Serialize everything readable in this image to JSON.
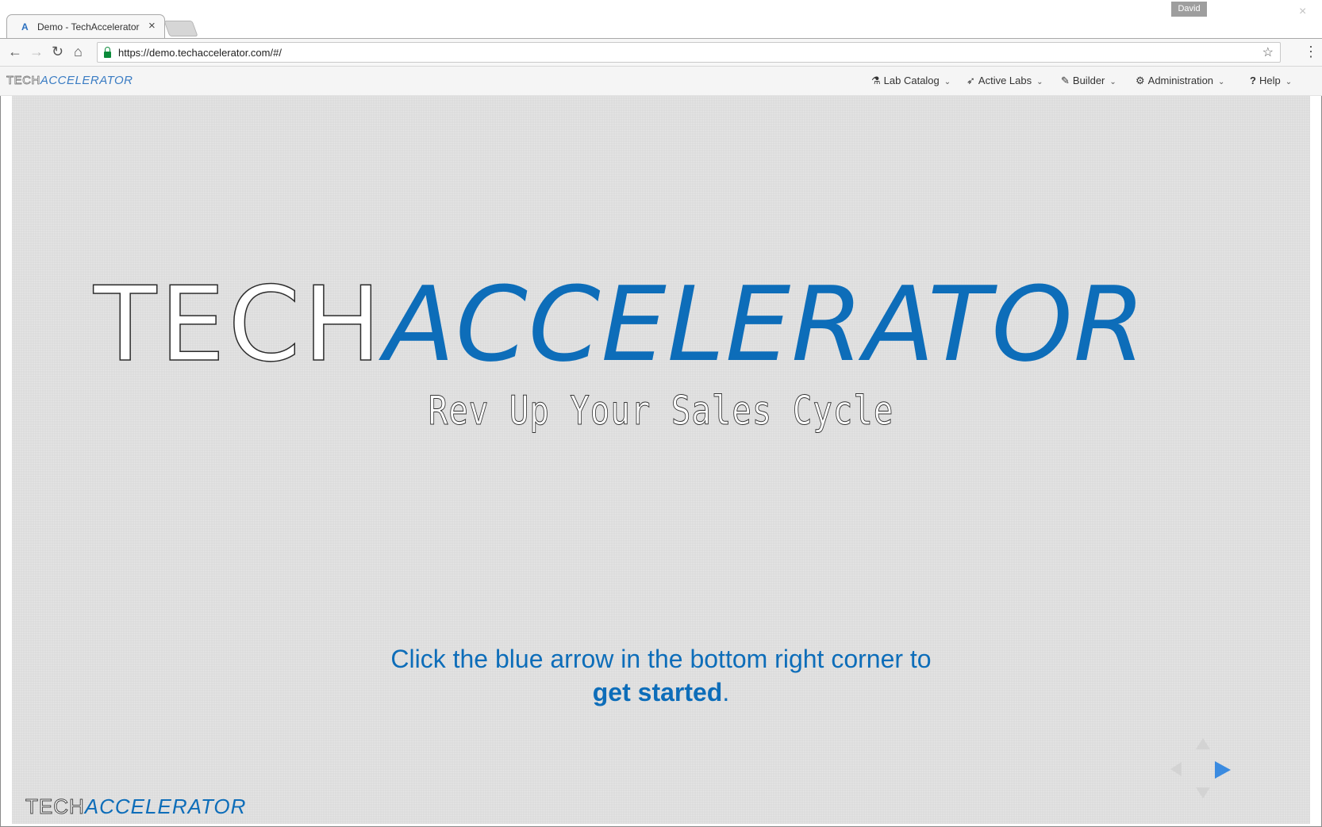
{
  "browser": {
    "tab_title": "Demo - TechAccelerator",
    "tab_close": "×",
    "favicon": "A",
    "profile_name": "David",
    "window_close": "×",
    "url": "https://demo.techaccelerator.com/#/",
    "icons": {
      "back": "←",
      "forward": "→",
      "reload": "↻",
      "home": "⌂",
      "star": "☆",
      "menu": "⋮"
    }
  },
  "nav": {
    "logo_tech": "TECH",
    "logo_accel": "ACCELERATOR",
    "items": [
      {
        "label": "Lab Catalog",
        "icon": "flask-icon",
        "glyph": "⚗"
      },
      {
        "label": "Active Labs",
        "icon": "rocket-icon",
        "glyph": "➶"
      },
      {
        "label": "Builder",
        "icon": "wrench-icon",
        "glyph": "✎"
      },
      {
        "label": "Administration",
        "icon": "gear-icon",
        "glyph": "⚙"
      },
      {
        "label": "Help",
        "icon": "question-icon",
        "glyph": "?"
      }
    ],
    "chevron": "⌄"
  },
  "slide": {
    "hero_tech": "TECH",
    "hero_accel": "ACCELERATOR",
    "tagline": "Rev Up Your Sales Cycle",
    "instruction_line1": "Click the blue arrow in the bottom right corner to",
    "instruction_strong": "get started",
    "instruction_end": ".",
    "footer_tech": "TECH",
    "footer_accel": "ACCELERATOR"
  },
  "colors": {
    "brand_blue": "#0d6db9",
    "arrow_blue": "#3b8be0",
    "slide_bg": "#dcdcdc"
  }
}
